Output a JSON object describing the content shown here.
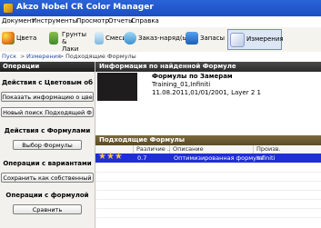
{
  "window": {
    "title": "Akzo Nobel CR Color Manager"
  },
  "menu": [
    "Документ",
    "Инструменты",
    "Просмотр",
    "Отчеты",
    "Справка"
  ],
  "toolbar": {
    "colors": "Цвета",
    "primers_line1": "Грунты &",
    "primers_line2": "Лаки",
    "mixes": "Смеси",
    "orders": "Заказ-наряд(ы)",
    "stocks": "Запасы",
    "measurements": "Измерения"
  },
  "breadcrumb": {
    "start": "Пуск",
    "sep1": ">",
    "measurements": "Измерения",
    "sep2": ">",
    "current": "Подходящие Формулы"
  },
  "left": {
    "header": "Операции",
    "section_color": "Действия с Цветовым об",
    "btn_show_info": "Показать информацию о цве",
    "btn_new_search": "Новый поиск Подходящей Ф",
    "section_formulas": "Действия с Формулами",
    "btn_select_formula": "Выбор Формулы",
    "section_variants": "Операции с вариантами",
    "btn_save_own": "Сохранить как собственный",
    "section_formula": "Операции с формулой",
    "btn_compare": "Сравнить"
  },
  "info": {
    "header": "Информация по найденной Формуле",
    "title": "Формулы по Замерам",
    "line1": "Training_01,Infiniti",
    "line2": "11.08.2011,01/01/2001, Layer 2 1"
  },
  "grid": {
    "header": "Подходящие Формулы",
    "columns": [
      "",
      "Различие ...",
      "Описание",
      "Произв."
    ],
    "rows": [
      {
        "stars": "★★★",
        "difference": "0.7",
        "description": "Оптимизированная формула",
        "manufacturer": "Infiniti"
      }
    ]
  },
  "colors": {
    "titlebar": "#1c4ec2",
    "selected_row": "#1f2ed6",
    "info_header": "#3b3b3b",
    "grid_header": "#6b5a32",
    "star": "#f5c23a"
  }
}
